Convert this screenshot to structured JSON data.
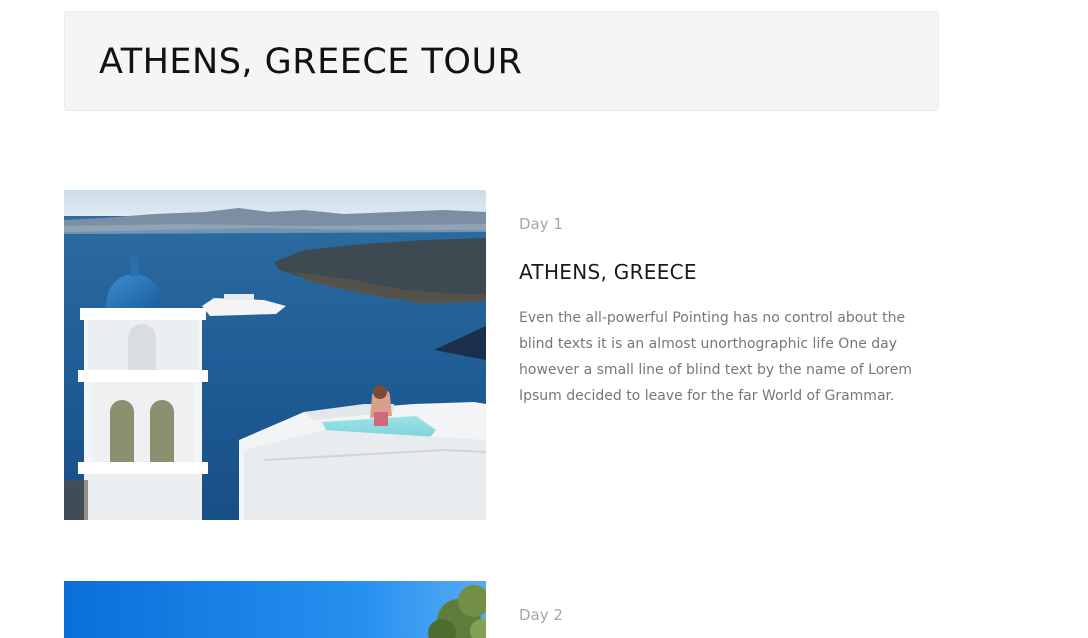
{
  "page": {
    "title": "ATHENS, GREECE TOUR"
  },
  "itinerary": [
    {
      "day_label": "Day 1",
      "title": "ATHENS, GREECE",
      "description": "Even the all-powerful Pointing has no control about the blind texts it is an almost unorthographic life One day however a small line of blind text by the name of Lorem Ipsum decided to leave for the far World of Grammar.",
      "image": "santorini-caldera-photo"
    },
    {
      "day_label": "Day 2",
      "image": "blue-sky-tree-photo"
    }
  ]
}
